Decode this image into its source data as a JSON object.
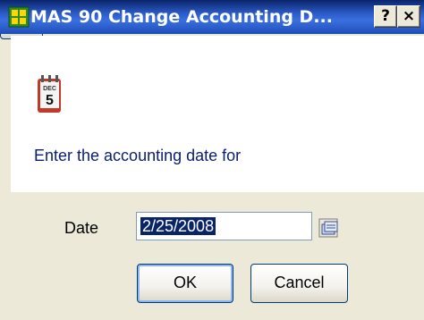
{
  "title": "MAS 90 Change Accounting D...",
  "titlebar_buttons": {
    "help": "?",
    "close": "×"
  },
  "calendar_icon": {
    "month": "DEC",
    "day": "5"
  },
  "prompt": "Enter the accounting date for",
  "date_field": {
    "label": "Date",
    "value": "2/25/2008"
  },
  "buttons": {
    "ok": "OK",
    "cancel": "Cancel"
  },
  "icons": [
    "app-icon",
    "calendar-icon",
    "calendar-lookup-icon",
    "help-circle-icon"
  ],
  "colors": {
    "titlebar": "#2c5cc8",
    "prompt_text": "#0a1e6e",
    "selection": "#0a246a"
  }
}
